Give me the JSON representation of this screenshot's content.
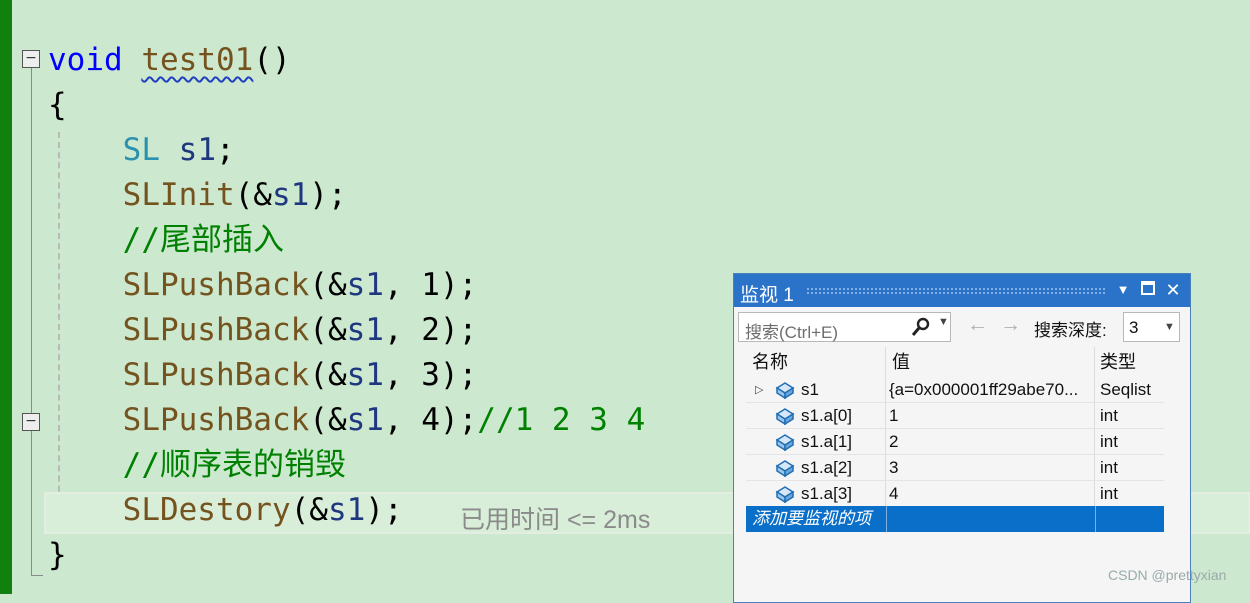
{
  "editor": {
    "lines": [
      {
        "kw": "void",
        "fn": "test01",
        "rest": "()"
      },
      {
        "text": "{"
      },
      {
        "type": "SL",
        "var": "s1",
        "rest": ";"
      },
      {
        "fn": "SLInit",
        "pre": "(&",
        "var": "s1",
        "rest": ");"
      },
      {
        "comment": "//尾部插入"
      },
      {
        "fn": "SLPushBack",
        "pre": "(&",
        "var": "s1",
        "rest": ", 1);"
      },
      {
        "fn": "SLPushBack",
        "pre": "(&",
        "var": "s1",
        "rest": ", 2);"
      },
      {
        "fn": "SLPushBack",
        "pre": "(&",
        "var": "s1",
        "rest": ", 3);"
      },
      {
        "fn": "SLPushBack",
        "pre": "(&",
        "var": "s1",
        "rest": ", 4);",
        "comment": "//1 2 3 4"
      },
      {
        "comment": "//顺序表的销毁"
      },
      {
        "fn": "SLDestory",
        "pre": "(&",
        "var": "s1",
        "rest": ");"
      },
      {
        "text": "}"
      }
    ],
    "perf_tip": "已用时间 <= 2ms"
  },
  "watch": {
    "title": "监视 1",
    "search_placeholder": "搜索(Ctrl+E)",
    "depth_label": "搜索深度:",
    "depth_value": "3",
    "columns": {
      "name": "名称",
      "value": "值",
      "type": "类型"
    },
    "rows": [
      {
        "name": "s1",
        "value": "{a=0x000001ff29abe70...",
        "type": "Seqlist"
      },
      {
        "name": "s1.a[0]",
        "value": "1",
        "type": "int"
      },
      {
        "name": "s1.a[1]",
        "value": "2",
        "type": "int"
      },
      {
        "name": "s1.a[2]",
        "value": "3",
        "type": "int"
      },
      {
        "name": "s1.a[3]",
        "value": "4",
        "type": "int"
      }
    ],
    "add_item": "添加要监视的项"
  },
  "watermark": "CSDN @prettyxian",
  "colors": {
    "editor_bg": "#cce8cf",
    "gutter": "#11800f",
    "title_bar": "#2b73c9",
    "selection": "#0a6fc8"
  }
}
